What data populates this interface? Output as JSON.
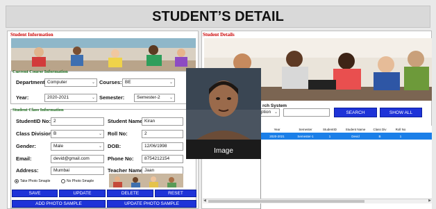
{
  "title": "STUDENT’S DETAIL",
  "left": {
    "section": "Student Information",
    "course_header": "Current Course Information",
    "department_label": "Department:",
    "department_value": "Computer",
    "courses_label": "Courses:",
    "courses_value": "BE",
    "year_label": "Year:",
    "year_value": "2020-2021",
    "semester_label": "Semester:",
    "semester_value": "Semester-2",
    "class_header": "Student Class Information",
    "studentid_label": "StudentID No:",
    "studentid_value": "2",
    "studentname_label": "Student Name:",
    "studentname_value": "Kiran",
    "division_label": "Class Division:",
    "division_value": "B",
    "roll_label": "Roll No:",
    "roll_value": "2",
    "gender_label": "Gender:",
    "gender_value": "Male",
    "dob_label": "DOB:",
    "dob_value": "12/06/1998",
    "email_label": "Email:",
    "email_value": "devid@gmail.com",
    "phone_label": "Phone No:",
    "phone_value": "8754212154",
    "address_label": "Address:",
    "address_value": "Mumbai",
    "teacher_label": "Teacher Name:",
    "teacher_value": "Jaan",
    "radio_take": "Take Photo Smaple",
    "radio_no": "No Photo Smaple",
    "buttons": [
      "SAVE",
      "UPDATE",
      "DELETE",
      "RESET"
    ],
    "add_photo": "ADD PHOTO SAMPLE",
    "update_photo": "UPDATE PHOTO SAMPLE"
  },
  "right": {
    "section": "Student Details",
    "search_header": "rch System",
    "search_by_value": "ption",
    "search_btn": "SEARCH",
    "showall_btn": "SHOW ALL",
    "columns": [
      "Year",
      "Semester",
      "StudentID",
      "Student Name",
      "Class Div",
      "Roll No"
    ],
    "row": [
      "2020-2021",
      "Semester-1",
      "1",
      "Devid",
      "B",
      "1"
    ]
  },
  "overlay_caption": "Image"
}
